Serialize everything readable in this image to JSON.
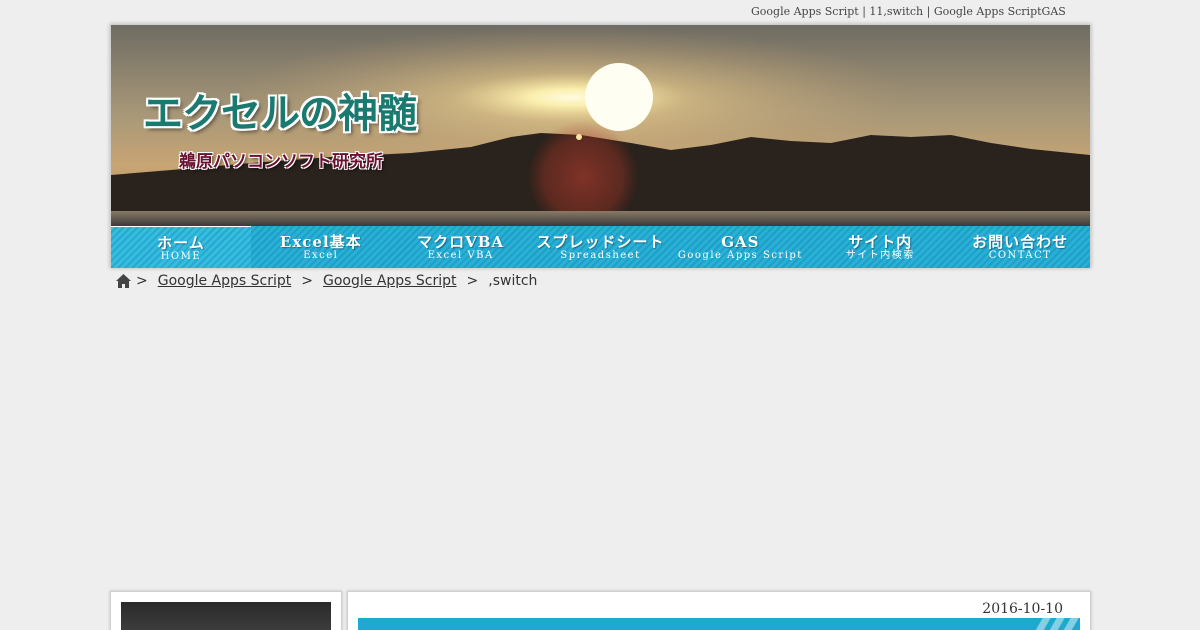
{
  "page_description": "Google Apps Script | 11,switch | Google Apps ScriptGAS",
  "header": {
    "site_title": "エクセルの神髄",
    "site_subtitle": "鵜原パソコンソフト研究所"
  },
  "nav": {
    "items": [
      {
        "label": "ホーム",
        "sub": "HOME"
      },
      {
        "label": "Excel基本",
        "sub": "Excel"
      },
      {
        "label": "マクロVBA",
        "sub": "Excel VBA"
      },
      {
        "label": "スプレッドシート",
        "sub": "Spreadsheet"
      },
      {
        "label": "GAS",
        "sub": "Google Apps Script"
      },
      {
        "label": "サイト内",
        "sub": "サイト内検索"
      },
      {
        "label": "お問い合わせ",
        "sub": "CONTACT"
      }
    ]
  },
  "breadcrumb": {
    "home_icon": "home-icon",
    "sep1": ">",
    "crumb1": "Google Apps Script",
    "sep2": ">",
    "crumb2": "Google Apps Script",
    "sep3": ">",
    "current": ",switch"
  },
  "post": {
    "date": "2016-10-10"
  },
  "colors": {
    "nav_blue": "#29b0d6",
    "title_teal": "#1a7a70",
    "subtitle_maroon": "#6a1030",
    "background": "#eeeeee"
  }
}
